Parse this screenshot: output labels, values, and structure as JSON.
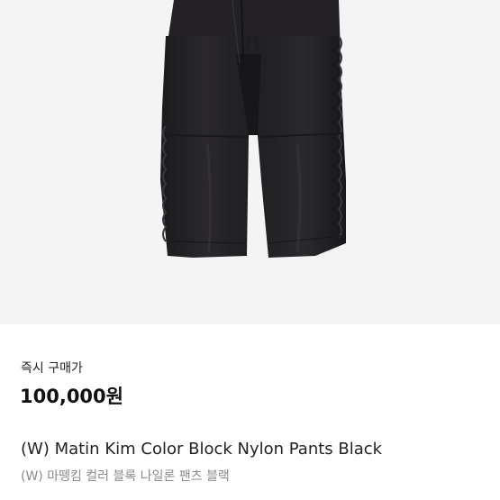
{
  "product": {
    "image_icon": "black-nylon-pants-photo",
    "price_label": "즉시 구매가",
    "price": "100,000원",
    "title_en": "(W) Matin Kim Color Block Nylon Pants Black",
    "title_ko": "(W) 마뗑킴 컬러 블록 나일론 팬츠 블랙"
  },
  "colors": {
    "image_background": "#f4f4f4",
    "pants": "#242226",
    "price_text": "#111111",
    "subtitle_text": "#8a8a8a"
  }
}
